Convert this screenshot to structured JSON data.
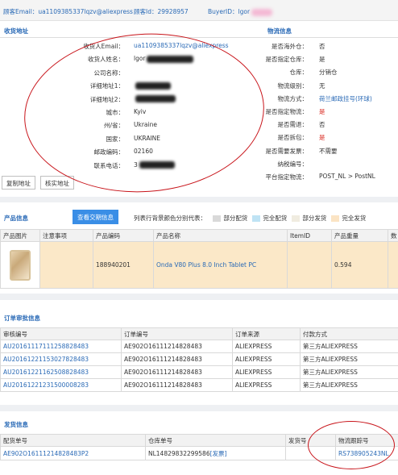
{
  "topbar": {
    "email_label": "顾客Email：",
    "email_value": "ua1109385337lqzv@aliexpress",
    "cid_label": "顾客Id：",
    "cid_value": "29928957",
    "buyer_label": "BuyerID：",
    "buyer_value": "lgor"
  },
  "address": {
    "title": "收货地址",
    "rows": [
      {
        "label": "收货人Email：",
        "value": "ua1109385337lqzv@aliexpress"
      },
      {
        "label": "收货人姓名：",
        "value": "lgor"
      },
      {
        "label": "公司名称：",
        "value": ""
      },
      {
        "label": "详细地址1：",
        "value": ""
      },
      {
        "label": "详细地址2：",
        "value": ""
      },
      {
        "label": "城市：",
        "value": "Kyiv"
      },
      {
        "label": "州/省：",
        "value": "Ukraine"
      },
      {
        "label": "国家：",
        "value": "UKRAINE"
      },
      {
        "label": "邮政编码：",
        "value": "02160"
      },
      {
        "label": "联系电话：",
        "value": "3"
      }
    ],
    "copy_button": "复制地址",
    "verify_button": "核实地址"
  },
  "logistics": {
    "title": "物流信息",
    "rows": [
      {
        "label": "是否海外仓：",
        "value": "否",
        "red": false
      },
      {
        "label": "是否指定仓库：",
        "value": "是",
        "red": false
      },
      {
        "label": "仓库：",
        "value": "分销仓",
        "red": false
      },
      {
        "label": "物流级别：",
        "value": "无",
        "red": false
      },
      {
        "label": "物流方式：",
        "value": "荷兰邮政挂号(环球)",
        "red": false,
        "link": true
      },
      {
        "label": "是否指定物流：",
        "value": "是",
        "red": true
      },
      {
        "label": "是否需退：",
        "value": "否",
        "red": false
      },
      {
        "label": "是否拆包：",
        "value": "是",
        "red": true
      },
      {
        "label": "是否需要发票：",
        "value": "不需要",
        "red": false
      },
      {
        "label": "纳税编号：",
        "value": "",
        "red": false
      },
      {
        "label": "平台指定物流：",
        "value": "POST_NL > PostNL",
        "red": false
      }
    ]
  },
  "products": {
    "title": "产品信息",
    "view_button": "查看交期信息",
    "legend_label": "列表行背景颜色分别代表：",
    "legend": [
      {
        "label": "部分配货",
        "color": "#d9d9d9"
      },
      {
        "label": "完全配货",
        "color": "#bfe3f4"
      },
      {
        "label": "部分发货",
        "color": "#f0ece0"
      },
      {
        "label": "完全发货",
        "color": "#fbe4c4"
      }
    ],
    "headers": [
      "产品图片",
      "注意事项",
      "产品编码",
      "产品名称",
      "ItemID",
      "产品重量",
      "数"
    ],
    "rows": [
      {
        "note": "",
        "code": "188940201",
        "name": "Onda V80 Plus 8.0 Inch Tablet PC",
        "item_id": "",
        "weight": "0.594",
        "qty": ""
      }
    ]
  },
  "audit": {
    "title": "订单审批信息",
    "headers": [
      "审核编号",
      "订单编号",
      "订单来源",
      "付款方式"
    ],
    "rows": [
      {
        "audit_no": "AU20161117111258828483",
        "order_no": "AE902O161112148284​83",
        "source": "ALIEXPRESS",
        "payment": "第三方ALIEXPRESS"
      },
      {
        "audit_no": "AU20161221153027828483",
        "order_no": "AE902O16111214828483",
        "source": "ALIEXPRESS",
        "payment": "第三方ALIEXPRESS"
      },
      {
        "audit_no": "AU20161221162508828483",
        "order_no": "AE902O16111214828483",
        "source": "ALIEXPRESS",
        "payment": "第三方ALIEXPRESS"
      },
      {
        "audit_no": "AU20161221231500008283",
        "order_no": "AE902O16111214828483",
        "source": "ALIEXPRESS",
        "payment": "第三方ALIEXPRESS"
      }
    ]
  },
  "shipping": {
    "title": "发货信息",
    "headers": [
      "配货单号",
      "仓库单号",
      "发货号",
      "物流跟踪号"
    ],
    "rows": [
      {
        "pick_no": "AE902O16111214828483P2",
        "wh_no": "NL1482983229958​6",
        "wh_link": "[发票]",
        "ship_no": "",
        "tracking": "RS738905243NL"
      }
    ]
  },
  "colors": {
    "accent": "#2a6ab6",
    "red": "#d9251c",
    "product_row": "#fbe8c8",
    "button_blue": "#3a8ee6"
  }
}
